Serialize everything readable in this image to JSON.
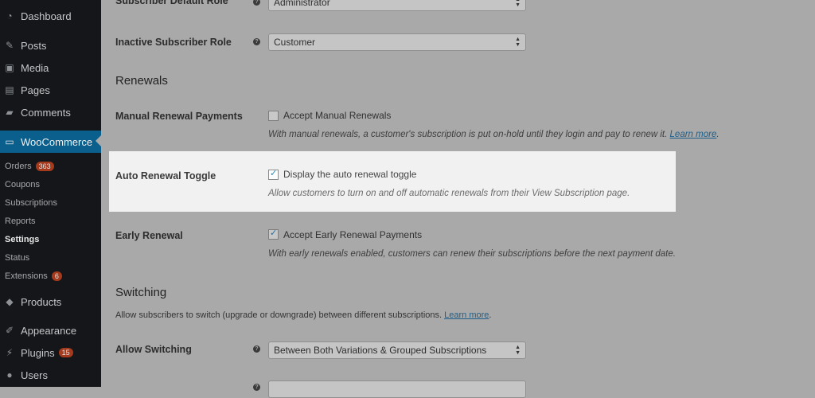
{
  "sidebar": {
    "items": [
      {
        "label": "Dashboard",
        "icon": "dashboard-icon"
      },
      {
        "label": "Posts",
        "icon": "pin-icon"
      },
      {
        "label": "Media",
        "icon": "media-icon"
      },
      {
        "label": "Pages",
        "icon": "pages-icon"
      },
      {
        "label": "Comments",
        "icon": "comment-icon"
      },
      {
        "label": "WooCommerce",
        "icon": "woocommerce-icon"
      },
      {
        "label": "Products",
        "icon": "box-icon"
      },
      {
        "label": "Appearance",
        "icon": "brush-icon"
      },
      {
        "label": "Plugins",
        "icon": "plug-icon",
        "badge": "15"
      },
      {
        "label": "Users",
        "icon": "user-icon"
      }
    ],
    "submenu": [
      {
        "label": "Orders",
        "badge": "363"
      },
      {
        "label": "Coupons"
      },
      {
        "label": "Subscriptions"
      },
      {
        "label": "Reports"
      },
      {
        "label": "Settings"
      },
      {
        "label": "Status"
      },
      {
        "label": "Extensions",
        "badge": "6"
      }
    ]
  },
  "main": {
    "default_role": {
      "label": "Subscriber Default Role",
      "value": "Administrator"
    },
    "inactive_role": {
      "label": "Inactive Subscriber Role",
      "value": "Customer"
    },
    "renewals_title": "Renewals",
    "manual_renewal": {
      "label": "Manual Renewal Payments",
      "checkbox_label": "Accept Manual Renewals",
      "checked": false,
      "description": "With manual renewals, a customer's subscription is put on-hold until they login and pay to renew it.",
      "link": "Learn more"
    },
    "auto_renewal": {
      "label": "Auto Renewal Toggle",
      "checkbox_label": "Display the auto renewal toggle",
      "checked": true,
      "description": "Allow customers to turn on and off automatic renewals from their View Subscription page."
    },
    "early_renewal": {
      "label": "Early Renewal",
      "checkbox_label": "Accept Early Renewal Payments",
      "checked": true,
      "description": "With early renewals enabled, customers can renew their subscriptions before the next payment date."
    },
    "switching_title": "Switching",
    "switching_desc": "Allow subscribers to switch (upgrade or downgrade) between different subscriptions.",
    "switching_link": "Learn more",
    "allow_switching": {
      "label": "Allow Switching",
      "value": "Between Both Variations & Grouped Subscriptions"
    },
    "check_glyph": "✓",
    "help_glyph": "?",
    "caret_glyph": "▲▼"
  }
}
